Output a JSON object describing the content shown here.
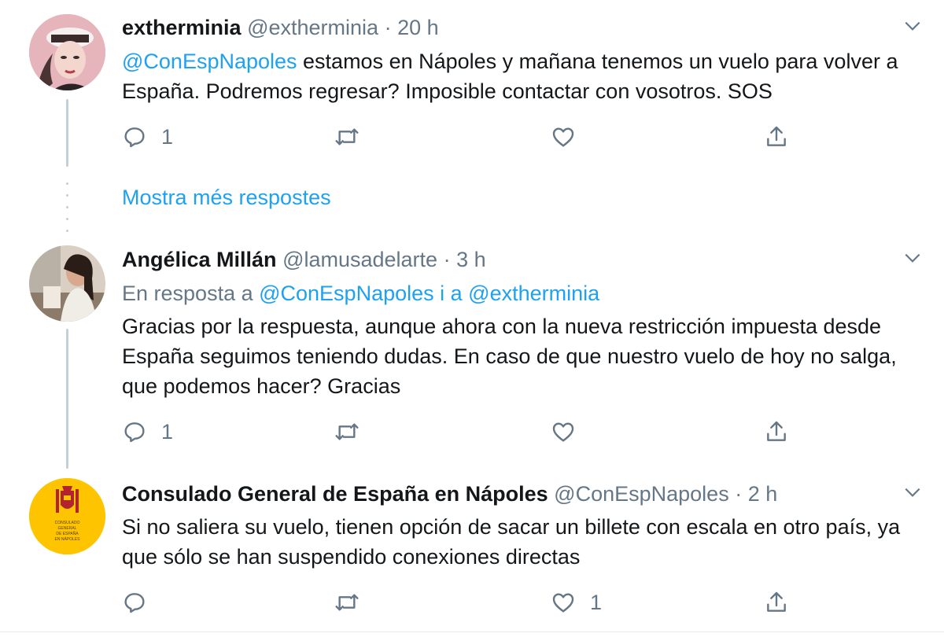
{
  "tweets": [
    {
      "name": "extherminia",
      "handle": "@extherminia",
      "separator": "·",
      "time": "20 h",
      "mention": "@ConEspNapoles",
      "text": " estamos en Nápoles y mañana tenemos un vuelo para volver a España. Podremos regresar? Imposible contactar con vosotros. SOS",
      "reply_count": "1",
      "retweet_count": "",
      "like_count": ""
    },
    {
      "name": "Angélica Millán",
      "handle": "@lamusadelarte",
      "separator": "·",
      "time": "3 h",
      "reply_prefix": "En resposta a ",
      "reply_targets": "@ConEspNapoles i a @extherminia",
      "text": "Gracias por la respuesta, aunque ahora con la nueva restricción impuesta desde España seguimos teniendo dudas. En caso de que nuestro vuelo de hoy no salga, que podemos hacer? Gracias",
      "reply_count": "1",
      "retweet_count": "",
      "like_count": ""
    },
    {
      "name": "Consulado General de España en Nápoles",
      "handle": "@ConEspNapoles",
      "separator": "·",
      "time": "2 h",
      "avatar_text": "CONSULADO GENERAL DE ESPAÑA EN NÁPOLES",
      "text": "Si no saliera su vuelo, tienen opción de sacar un billete con escala en otro país, ya que sólo se han suspendido conexiones directas",
      "reply_count": "",
      "retweet_count": "",
      "like_count": "1"
    }
  ],
  "show_more": "Mostra més respostes",
  "colors": {
    "link": "#1da1f2",
    "muted": "#657786",
    "thread": "#c4cfd6",
    "consulate_yellow": "#ffc400"
  },
  "icons": [
    "reply-icon",
    "retweet-icon",
    "like-icon",
    "share-icon",
    "chevron-down-icon"
  ]
}
